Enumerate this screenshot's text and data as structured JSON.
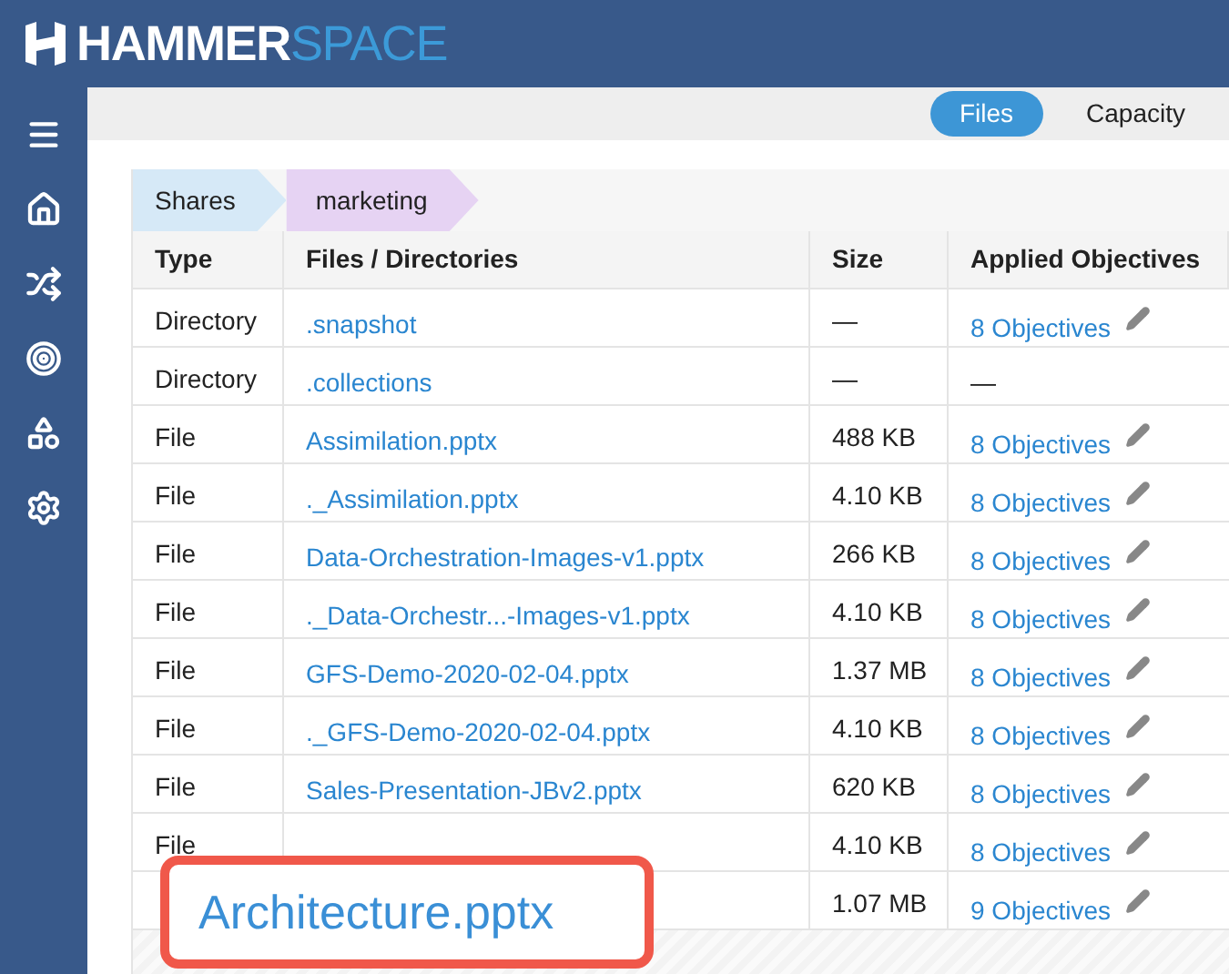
{
  "logo": {
    "left": "HAMMER",
    "right": "SPACE"
  },
  "tabs": [
    {
      "label": "Files",
      "selected": true
    },
    {
      "label": "Capacity",
      "selected": false
    }
  ],
  "breadcrumb": [
    {
      "label": "Shares",
      "selected": false
    },
    {
      "label": "marketing",
      "selected": true
    }
  ],
  "table": {
    "columns": [
      "Type",
      "Files / Directories",
      "Size",
      "Applied Objectives"
    ],
    "rows": [
      {
        "type": "Directory",
        "name": ".snapshot",
        "size": "—",
        "objectives": "8 Objectives",
        "editable": true
      },
      {
        "type": "Directory",
        "name": ".collections",
        "size": "—",
        "objectives": "—",
        "editable": false
      },
      {
        "type": "File",
        "name": "Assimilation.pptx",
        "size": "488 KB",
        "objectives": "8 Objectives",
        "editable": true
      },
      {
        "type": "File",
        "name": "._Assimilation.pptx",
        "size": "4.10 KB",
        "objectives": "8 Objectives",
        "editable": true
      },
      {
        "type": "File",
        "name": "Data-Orchestration-Images-v1.pptx",
        "size": "266 KB",
        "objectives": "8 Objectives",
        "editable": true
      },
      {
        "type": "File",
        "name": "._Data-Orchestr...-Images-v1.pptx",
        "size": "4.10 KB",
        "objectives": "8 Objectives",
        "editable": true
      },
      {
        "type": "File",
        "name": "GFS-Demo-2020-02-04.pptx",
        "size": "1.37 MB",
        "objectives": "8 Objectives",
        "editable": true
      },
      {
        "type": "File",
        "name": "._GFS-Demo-2020-02-04.pptx",
        "size": "4.10 KB",
        "objectives": "8 Objectives",
        "editable": true
      },
      {
        "type": "File",
        "name": "Sales-Presentation-JBv2.pptx",
        "size": "620 KB",
        "objectives": "8 Objectives",
        "editable": true
      },
      {
        "type": "File",
        "size": "4.10 KB",
        "objectives": "8 Objectives",
        "editable": true
      },
      {
        "size": "1.07 MB",
        "objectives": "9 Objectives",
        "editable": true
      }
    ]
  },
  "callout": {
    "text": "Architecture.pptx"
  }
}
